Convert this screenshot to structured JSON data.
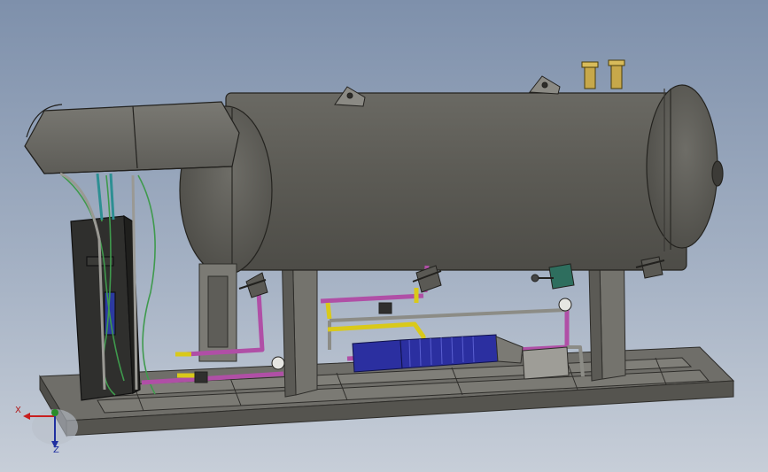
{
  "triad": {
    "x_label": "X",
    "z_label": "Z"
  },
  "colors": {
    "background_top": "#7e90ab",
    "background_bottom": "#c7ced8",
    "tank_body": "#5c5b55",
    "frame": "#6f6e69",
    "pipe_magenta": "#b04fa6",
    "pipe_yellow": "#d9c91a",
    "pipe_gray": "#8c8c86",
    "pump_motor": "#2b2fa0",
    "hose_green": "#3f9a4d",
    "axis_x": "#c81e1e",
    "axis_y": "#2a8c2a",
    "axis_z": "#1f2fa0"
  }
}
